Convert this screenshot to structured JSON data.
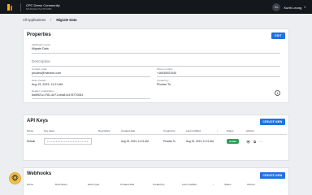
{
  "header": {
    "org_name": "CPC Demo Community",
    "org_subtitle": "MANAGE PLATFORM",
    "user_initials": "KL",
    "user_name": "Kurth Leung"
  },
  "breadcrumb": {
    "parent": "All Applications",
    "separator": "/",
    "current": "Migrate Data"
  },
  "properties": {
    "title": "Properties",
    "edit_label": "EDIT",
    "app_name_label": "Application name",
    "app_name": "Migrate Data",
    "description_placeholder": "Description",
    "contact_email_label": "Contact email",
    "contact_email": "phodes@martech.com",
    "phone_label": "Phone number",
    "phone": "+16045001040",
    "date_created_label": "Date created",
    "date_created": "Aug 15, 2023, 11:21 AM",
    "created_by_label": "Created by",
    "created_by": "Phodse Tu",
    "header_label": "Header x-application",
    "header_value": "6dd9f21c-f781-4e71-bbd8-fc478770081"
  },
  "api_keys": {
    "title": "API Keys",
    "create_label": "CREATE NEW",
    "columns": [
      "Name",
      "Key token",
      "Description",
      "Created date",
      "Created by",
      "Last modified",
      "Status",
      "Actions"
    ],
    "rows": [
      {
        "name": "Default",
        "token": "••••••••••••••••••••••••",
        "description": "",
        "created": "Aug 15, 2023, 11:21 AM",
        "created_by": "Phodse Tu",
        "modified": "Aug 15, 2023, 11:21 AM",
        "status": "Active"
      }
    ]
  },
  "webhooks": {
    "title": "Webhooks",
    "create_label": "CREATE NEW",
    "columns": [
      "Name",
      "Description",
      "Event type",
      "Created date",
      "Created by",
      "Last modified",
      "Status",
      "Actions"
    ]
  }
}
